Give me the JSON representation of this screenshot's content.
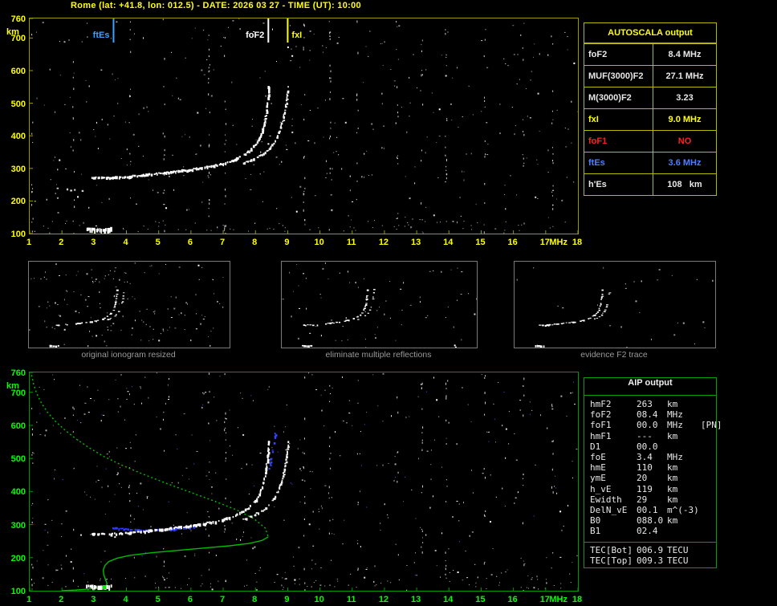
{
  "title": "Rome (lat: +41.8, lon: 012.5) - DATE: 2026 03 27 - TIME (UT): 10:00",
  "colors": {
    "bg": "#000000",
    "yellow": "#ffff00",
    "axis_top": "#9a9a00",
    "green": "#00ff00",
    "axis_bottom": "#009900",
    "white": "#e8e8e8",
    "red": "#ff2020",
    "blue": "#4f7dff",
    "grey": "#9a9a9a",
    "profile": "#00bb00",
    "trace_blue": "#2b3bff"
  },
  "ionogram": {
    "x_unit": "MHz",
    "y_unit": "km",
    "freq_min": 1,
    "freq_max": 18,
    "height_min": 100,
    "height_max": 760,
    "x_ticks": [
      1,
      2,
      3,
      4,
      5,
      6,
      7,
      8,
      9,
      10,
      11,
      12,
      13,
      14,
      15,
      16,
      17,
      18
    ],
    "y_ticks": [
      760,
      700,
      600,
      500,
      400,
      300,
      200,
      100
    ],
    "o_trace": [
      [
        2.9,
        272
      ],
      [
        3.3,
        270
      ],
      [
        3.8,
        272
      ],
      [
        4.3,
        276
      ],
      [
        4.8,
        281
      ],
      [
        5.3,
        287
      ],
      [
        5.8,
        293
      ],
      [
        6.3,
        300
      ],
      [
        6.8,
        309
      ],
      [
        7.2,
        320
      ],
      [
        7.5,
        333
      ],
      [
        7.8,
        352
      ],
      [
        8.0,
        374
      ],
      [
        8.15,
        400
      ],
      [
        8.25,
        430
      ],
      [
        8.31,
        462
      ],
      [
        8.35,
        495
      ],
      [
        8.38,
        525
      ],
      [
        8.4,
        555
      ]
    ],
    "x_trace": [
      [
        7.6,
        315
      ],
      [
        7.9,
        326
      ],
      [
        8.2,
        342
      ],
      [
        8.45,
        362
      ],
      [
        8.62,
        388
      ],
      [
        8.75,
        418
      ],
      [
        8.85,
        452
      ],
      [
        8.92,
        488
      ],
      [
        8.97,
        522
      ],
      [
        9.0,
        555
      ]
    ],
    "es_trace": [
      [
        2.75,
        113
      ],
      [
        3.0,
        110
      ],
      [
        3.25,
        109
      ],
      [
        3.45,
        111
      ],
      [
        3.55,
        116
      ]
    ],
    "aux_trace": [
      [
        1.55,
        243
      ],
      [
        1.9,
        238
      ],
      [
        2.3,
        234
      ],
      [
        2.65,
        231
      ]
    ],
    "rfi_freqs": [
      1.07,
      2.35,
      4.1,
      5.15,
      6.55,
      7.05,
      9.5,
      10.3,
      11.15,
      12.4,
      13.15,
      13.9,
      15.1,
      16.3,
      17.2
    ],
    "markers": [
      {
        "label": "ftEs",
        "freq": 3.6,
        "color": "#3fa0ff"
      },
      {
        "label": "foF2",
        "freq": 8.4,
        "color": "#ffffff"
      },
      {
        "label": "fxI",
        "freq": 9.0,
        "color": "#ffff00"
      }
    ]
  },
  "profile": {
    "topside": [
      [
        1.06,
        752
      ],
      [
        1.12,
        725
      ],
      [
        1.22,
        696
      ],
      [
        1.36,
        668
      ],
      [
        1.55,
        640
      ],
      [
        1.8,
        612
      ],
      [
        2.1,
        585
      ],
      [
        2.45,
        558
      ],
      [
        2.85,
        532
      ],
      [
        3.3,
        506
      ],
      [
        3.85,
        480
      ],
      [
        4.5,
        453
      ],
      [
        5.2,
        426
      ],
      [
        5.95,
        399
      ],
      [
        6.7,
        372
      ],
      [
        7.4,
        345
      ],
      [
        7.95,
        318
      ],
      [
        8.3,
        290
      ],
      [
        8.4,
        263
      ]
    ],
    "bottomside": [
      [
        8.4,
        263
      ],
      [
        8.2,
        252
      ],
      [
        7.8,
        243
      ],
      [
        7.2,
        236
      ],
      [
        6.4,
        229
      ],
      [
        5.6,
        222
      ],
      [
        4.8,
        215
      ],
      [
        4.1,
        207
      ],
      [
        3.7,
        198
      ],
      [
        3.45,
        188
      ],
      [
        3.33,
        176
      ],
      [
        3.28,
        162
      ],
      [
        3.3,
        148
      ],
      [
        3.35,
        134
      ],
      [
        3.4,
        121
      ],
      [
        3.35,
        113
      ],
      [
        3.15,
        108
      ],
      [
        2.8,
        105
      ],
      [
        2.4,
        102
      ],
      [
        2.0,
        100
      ]
    ]
  },
  "restored_trace": [
    [
      3.55,
      290
    ],
    [
      4.0,
      284
    ],
    [
      4.6,
      282
    ],
    [
      5.2,
      284
    ],
    [
      5.8,
      289
    ],
    [
      6.2,
      294
    ]
  ],
  "restored_upper": [
    [
      8.42,
      470
    ],
    [
      8.47,
      500
    ],
    [
      8.52,
      528
    ],
    [
      8.57,
      556
    ],
    [
      8.62,
      585
    ]
  ],
  "autoscala_table": {
    "header": "AUTOSCALA output",
    "rows": [
      {
        "label": "foF2",
        "value": "8.4 MHz",
        "color": "white"
      },
      {
        "label": "MUF(3000)F2",
        "value": "27.1 MHz",
        "color": "white"
      },
      {
        "label": "M(3000)F2",
        "value": "3.23",
        "color": "white"
      },
      {
        "label": "fxI",
        "value": "9.0 MHz",
        "color": "yellow"
      },
      {
        "label": "foF1",
        "value": "NO",
        "color": "red"
      },
      {
        "label": "ftEs",
        "value": "3.6 MHz",
        "color": "blue"
      },
      {
        "label": "h'Es",
        "value": "108   km",
        "color": "white"
      }
    ]
  },
  "thumbnails": [
    {
      "caption": "original ionogram resized"
    },
    {
      "caption": "eliminate multiple reflections"
    },
    {
      "caption": "evidence F2 trace"
    }
  ],
  "aip_table": {
    "header": "AIP output",
    "rows": [
      {
        "label": "hmF2",
        "value": "263",
        "unit": "km",
        "note": ""
      },
      {
        "label": "foF2",
        "value": "08.4",
        "unit": "MHz",
        "note": ""
      },
      {
        "label": "foF1",
        "value": "00.0",
        "unit": "MHz",
        "note": "[PN]"
      },
      {
        "label": "hmF1",
        "value": "---",
        "unit": "km",
        "note": ""
      },
      {
        "label": "D1",
        "value": "00.0",
        "unit": "",
        "note": ""
      },
      {
        "label": "foE",
        "value": "3.4",
        "unit": "MHz",
        "note": ""
      },
      {
        "label": "hmE",
        "value": "110",
        "unit": "km",
        "note": ""
      },
      {
        "label": "ymE",
        "value": "20",
        "unit": "km",
        "note": ""
      },
      {
        "label": "h_vE",
        "value": "119",
        "unit": "km",
        "note": ""
      },
      {
        "label": "Ewidth",
        "value": "29",
        "unit": "km",
        "note": ""
      },
      {
        "label": "DelN_vE",
        "value": "00.1",
        "unit": "m^(-3)",
        "note": ""
      },
      {
        "label": "B0",
        "value": "088.0",
        "unit": "km",
        "note": ""
      },
      {
        "label": "B1",
        "value": "02.4",
        "unit": "",
        "note": ""
      }
    ],
    "tec_rows": [
      {
        "label": "TEC[Bot]",
        "value": "006.9",
        "unit": "TECU"
      },
      {
        "label": "TEC[Top]",
        "value": "009.3",
        "unit": "TECU"
      }
    ]
  },
  "noise": {
    "top_seed": 7,
    "top_count": 380,
    "bottom_seed": 11,
    "bottom_count": 430,
    "thumb_seeds": [
      21,
      22,
      23
    ],
    "thumb_counts": [
      150,
      70,
      28
    ],
    "band_count": 70,
    "blue_count": 36
  }
}
